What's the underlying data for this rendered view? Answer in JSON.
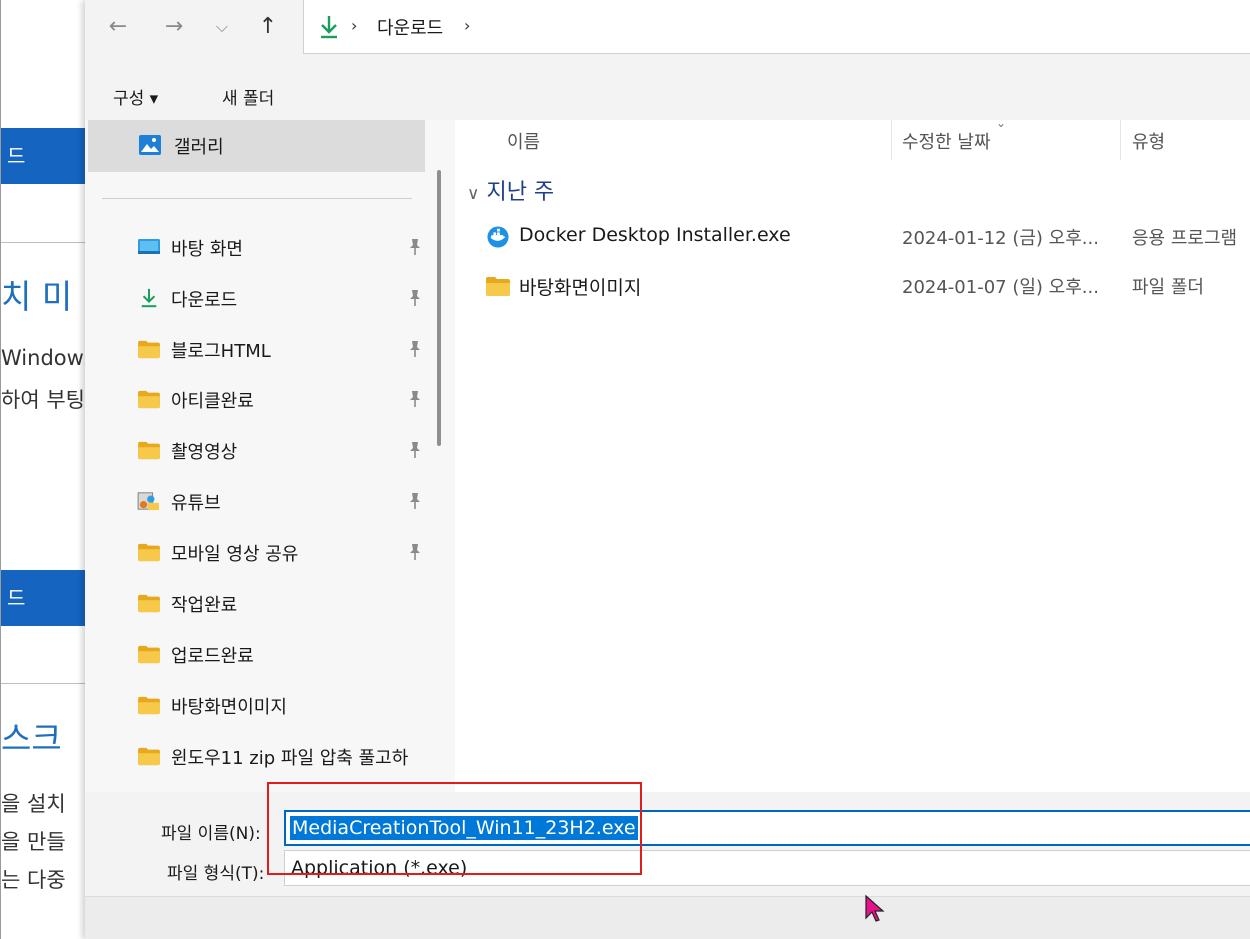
{
  "background_page": {
    "band1": "드",
    "heading1": "치 미",
    "text1": "Windows",
    "text2": "하여 부팅",
    "band2": "드",
    "heading2": "스크",
    "text3": "을 설치",
    "text4": "을 만들",
    "text5": "는 다중"
  },
  "address_bar": {
    "path_label": "다운로드",
    "separator": "›"
  },
  "command_bar": {
    "organize_label": "구성 ▾",
    "new_folder_label": "새 폴더"
  },
  "sidebar": {
    "gallery_label": "갤러리",
    "items": [
      {
        "label": "바탕 화면",
        "icon": "desktop-icon",
        "pinned": true
      },
      {
        "label": "다운로드",
        "icon": "download-icon",
        "pinned": true
      },
      {
        "label": "블로그HTML",
        "icon": "folder-icon",
        "pinned": true
      },
      {
        "label": "아티클완료",
        "icon": "folder-icon",
        "pinned": true
      },
      {
        "label": "촬영영상",
        "icon": "folder-icon",
        "pinned": true
      },
      {
        "label": "유튜브",
        "icon": "media-folder-icon",
        "pinned": true
      },
      {
        "label": "모바일 영상 공유",
        "icon": "folder-icon",
        "pinned": true
      },
      {
        "label": "작업완료",
        "icon": "folder-icon",
        "pinned": false
      },
      {
        "label": "업로드완료",
        "icon": "folder-icon",
        "pinned": false
      },
      {
        "label": "바탕화면이미지",
        "icon": "folder-icon",
        "pinned": false
      },
      {
        "label": "윈도우11 zip 파일 압축 풀고하",
        "icon": "folder-icon",
        "pinned": false
      }
    ]
  },
  "file_list": {
    "columns": {
      "name": "이름",
      "modified": "수정한 날짜",
      "type": "유형"
    },
    "group_label": "지난 주",
    "rows": [
      {
        "name": "Docker Desktop Installer.exe",
        "modified": "2024-01-12 (금) 오후...",
        "type": "응용 프로그램",
        "icon": "docker-app-icon"
      },
      {
        "name": "바탕화면이미지",
        "modified": "2024-01-07 (일) 오후...",
        "type": "파일 폴더",
        "icon": "folder-icon"
      }
    ]
  },
  "save_form": {
    "filename_label": "파일 이름(N):",
    "filename_value": "MediaCreationTool_Win11_23H2.exe",
    "filetype_label": "파일 형식(T):",
    "filetype_value": "Application (*.exe)"
  },
  "colors": {
    "accent": "#0078d7",
    "highlight_box": "#e01c1c",
    "folder": "#f4c542",
    "download_green": "#1a9e5c"
  }
}
